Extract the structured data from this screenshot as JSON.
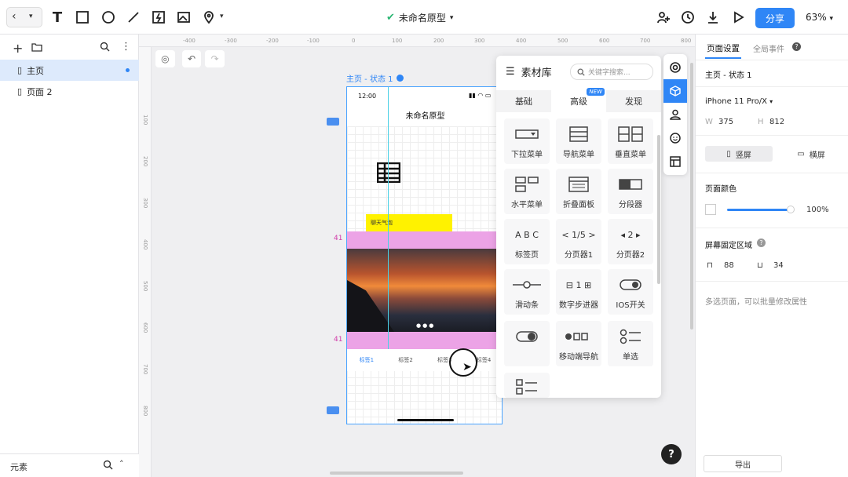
{
  "app": {
    "title": "未命名原型",
    "share": "分享",
    "zoom": "63%"
  },
  "left": {
    "pages": [
      {
        "label": "主页"
      },
      {
        "label": "页面 2"
      }
    ],
    "footer": "元素"
  },
  "ruler": {
    "top": [
      "-400",
      "-300",
      "-200",
      "-100",
      "0",
      "100",
      "200",
      "300",
      "400",
      "500",
      "600",
      "700",
      "800"
    ],
    "left": [
      "100",
      "200",
      "300",
      "400",
      "500",
      "600",
      "700",
      "800"
    ]
  },
  "canvas": {
    "page_label": "主页 - 状态 1",
    "time": "12:00",
    "app_title": "未命名原型",
    "bubble": "聊天气泡",
    "marker": "41",
    "tabs": [
      "标签1",
      "标签2",
      "标签3",
      "标签4"
    ]
  },
  "library": {
    "title": "素材库",
    "search_placeholder": "关键字搜索...",
    "tabs": [
      "基础",
      "高级",
      "发现"
    ],
    "new_badge": "NEW",
    "items": [
      {
        "label": "下拉菜单",
        "icon": "dropdown-icon"
      },
      {
        "label": "导航菜单",
        "icon": "nav-menu-icon"
      },
      {
        "label": "垂直菜单",
        "icon": "vertical-menu-icon"
      },
      {
        "label": "水平菜单",
        "icon": "horizontal-menu-icon"
      },
      {
        "label": "折叠面板",
        "icon": "collapse-panel-icon"
      },
      {
        "label": "分段器",
        "icon": "segment-icon"
      },
      {
        "label": "标签页",
        "icon": "tabs-icon",
        "glyph": "A B C"
      },
      {
        "label": "分页器1",
        "icon": "pager1-icon",
        "glyph": "< 1/5 >"
      },
      {
        "label": "分页器2",
        "icon": "pager2-icon",
        "glyph": "◂ 2 ▸"
      },
      {
        "label": "滑动条",
        "icon": "slider-icon"
      },
      {
        "label": "数字步进器",
        "icon": "stepper-icon",
        "glyph": "⊟ 1 ⊞"
      },
      {
        "label": "IOS开关",
        "icon": "ios-switch-icon"
      },
      {
        "label": "",
        "icon": "toggle-icon"
      },
      {
        "label": "移动端导航",
        "icon": "mobile-nav-icon"
      },
      {
        "label": "单选",
        "icon": "radio-icon"
      },
      {
        "label": "",
        "icon": "checkbox-list-icon"
      }
    ]
  },
  "right": {
    "tabs": [
      "页面设置",
      "全局事件"
    ],
    "state": "主页 - 状态 1",
    "device": "iPhone 11 Pro/X",
    "w_label": "W",
    "w": "375",
    "h_label": "H",
    "h": "812",
    "portrait": "竖屏",
    "landscape": "横屏",
    "color_label": "页面颜色",
    "opacity": "100%",
    "fixed_label": "屏幕固定区域",
    "top_fixed": "88",
    "bottom_fixed": "34",
    "multi_hint": "多选页面，可以批量修改属性",
    "export": "导出"
  }
}
